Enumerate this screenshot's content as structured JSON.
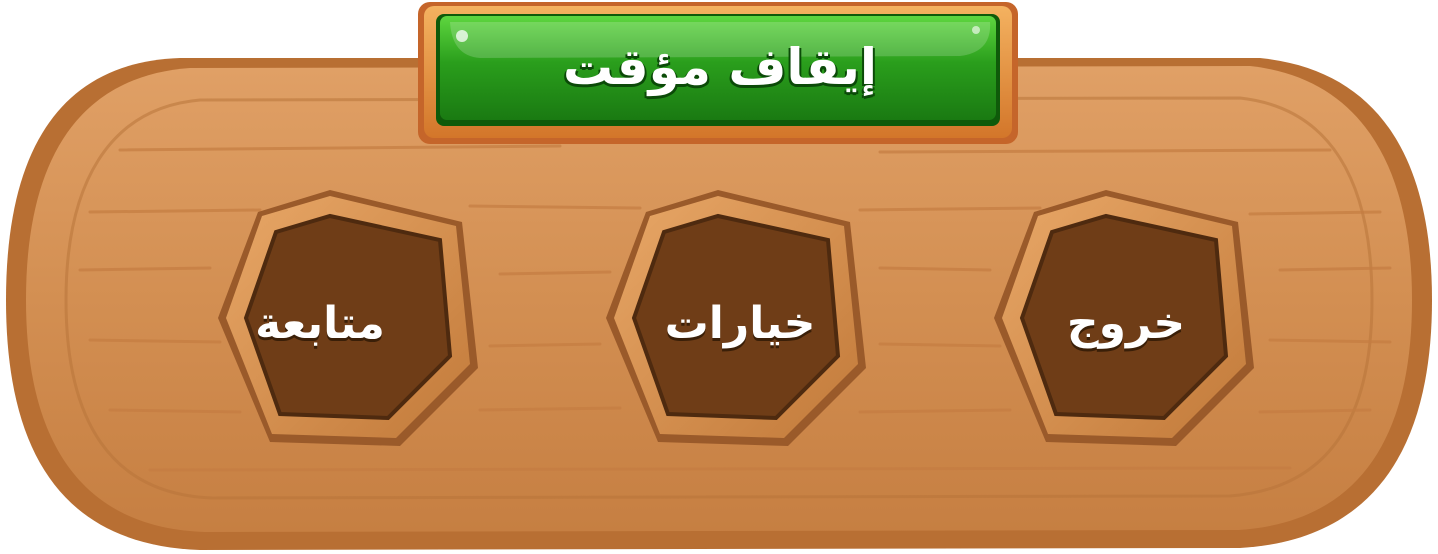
{
  "pause_menu": {
    "title": "إيقاف مؤقت",
    "buttons": [
      {
        "id": "continue",
        "label": "متابعة"
      },
      {
        "id": "options",
        "label": "خيارات"
      },
      {
        "id": "exit",
        "label": "خروج"
      }
    ]
  },
  "colors": {
    "wood_light": "#d9955a",
    "wood_mid": "#c47f43",
    "wood_dark": "#8a4e22",
    "button_inner": "#6f3d17",
    "title_green": "#2a9a1e",
    "title_frame": "#e08a3a"
  }
}
